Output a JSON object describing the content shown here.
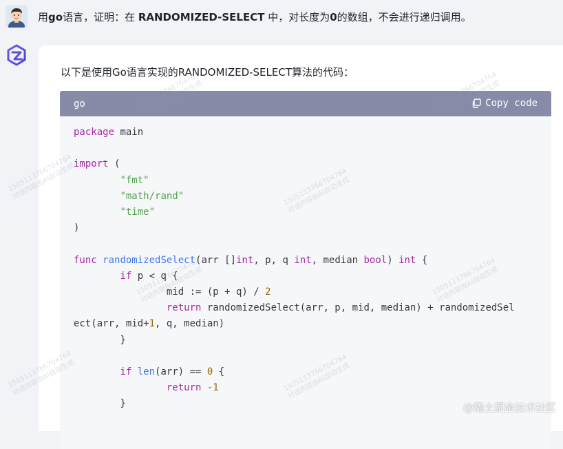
{
  "user_message": {
    "prefix": "用",
    "go": "go",
    "middle": "语言，证明：在 ",
    "algo": "RANDOMIZED-SELECT",
    "after_algo": " 中，对长度为",
    "zero": "0",
    "suffix": "的数组，不会进行递归调用。"
  },
  "assistant": {
    "intro": "以下是使用Go语言实现的RANDOMIZED-SELECT算法的代码："
  },
  "code_block": {
    "language": "go",
    "copy_label": "Copy code",
    "copy_icon": "copy-icon"
  },
  "code": {
    "t1": "package",
    "t2": "main",
    "t3": "import",
    "t4": "(",
    "t5": "\"fmt\"",
    "t6": "\"math/rand\"",
    "t7": "\"time\"",
    "t8": ")",
    "t9": "func",
    "t10": "randomizedSelect",
    "t11": "(arr []",
    "t12": "int",
    "t13": ", p, q ",
    "t14": "int",
    "t15": ", median ",
    "t16": "bool",
    "t17": ") ",
    "t18": "int",
    "t19": " {",
    "t20": "if",
    "t21": " p < q {",
    "t22": "mid := (p + q) / ",
    "t23": "2",
    "t24": "return",
    "t25": " randomizedSelect(arr, p, mid, median) + randomizedSel",
    "t26": "ect(arr, mid+",
    "t27": "1",
    "t28": ", q, median)",
    "t29": "}",
    "t30": "if",
    "t31": "len",
    "t32": "(arr) == ",
    "t33": "0",
    "t34": " {",
    "t35": "return",
    "t36": "-1",
    "t37": "}"
  },
  "watermarks": {
    "id": "15051137667047​64",
    "note": "对话内容由AI自动生成",
    "corner": "@稀土掘金技术社区"
  }
}
